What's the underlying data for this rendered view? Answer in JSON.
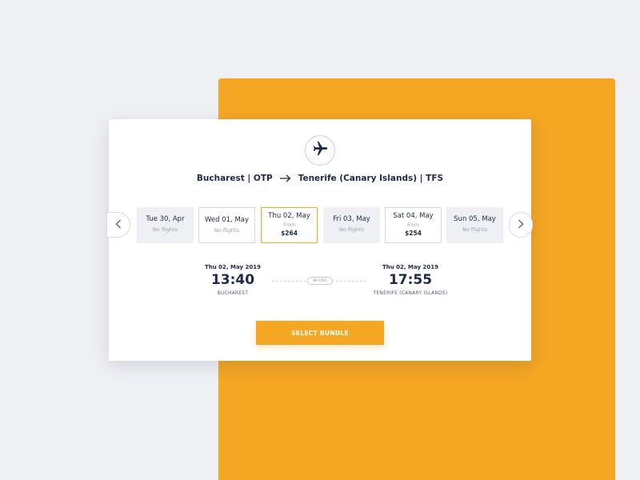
{
  "colors": {
    "accent": "#f5a623",
    "text": "#1f2a48",
    "background": "#eff0f4"
  },
  "header": {
    "icon": "airplane-icon",
    "origin": "Bucharest | OTP",
    "destination": "Tenerife (Canary Islands) | TFS"
  },
  "date_nav": {
    "prev_icon": "chevron-left-icon",
    "next_icon": "chevron-right-icon"
  },
  "dates": [
    {
      "label": "Tue 30, Apr",
      "status": "No flights"
    },
    {
      "label": "Wed 01, May",
      "status": "No flights"
    },
    {
      "label": "Thu 02, May",
      "from": "From",
      "price": "$264",
      "selected": true
    },
    {
      "label": "Fri 03, May",
      "status": "No flights"
    },
    {
      "label": "Sat 04, May",
      "from": "From",
      "price": "$254"
    },
    {
      "label": "Sun 05, May",
      "status": "No flights"
    }
  ],
  "flight": {
    "departure": {
      "date": "Thu 02, May 2019",
      "time": "13:40",
      "city": "BUCHAREST"
    },
    "duration": "6h 15m",
    "arrival": {
      "date": "Thu 02, May 2019",
      "time": "17:55",
      "city": "TENERIFE (CANARY ISLANDS)"
    }
  },
  "actions": {
    "select_label": "SELECT BUNDLE"
  }
}
